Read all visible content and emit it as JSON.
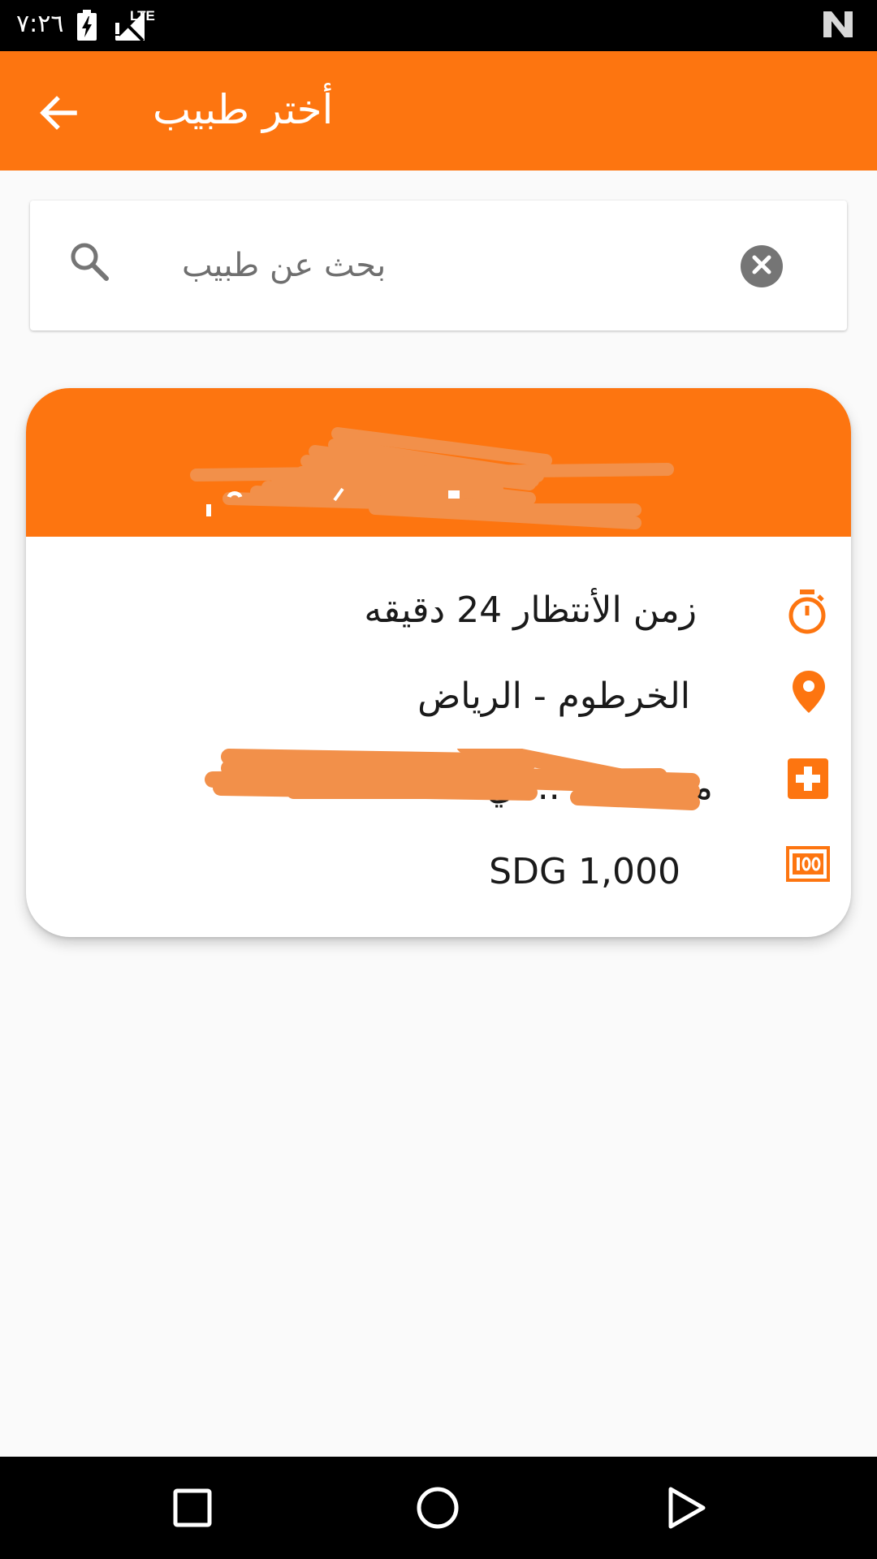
{
  "status_bar": {
    "time": "٧:٢٦",
    "network": "LTE"
  },
  "app_bar": {
    "title": "أختر طبيب",
    "back_icon": "arrow-back-icon"
  },
  "search": {
    "placeholder": "بحث عن طبيب",
    "value": "",
    "search_icon": "search-icon",
    "clear_icon": "clear-circle-icon"
  },
  "doctor_card": {
    "wait_time": "زمن الأنتظار 24 دقيقه",
    "location": "الخرطوم - الرياض",
    "hospital_visible": "مستشفى ... ي",
    "fee": "SDG 1,000",
    "icons": [
      "timer-icon",
      "location-pin-icon",
      "hospital-icon",
      "money-icon"
    ]
  },
  "colors": {
    "accent": "#fd7510",
    "redaction": "#f2904a"
  },
  "nav_bar": {
    "icons": [
      "recents-square-icon",
      "home-circle-icon",
      "back-triangle-icon"
    ]
  }
}
